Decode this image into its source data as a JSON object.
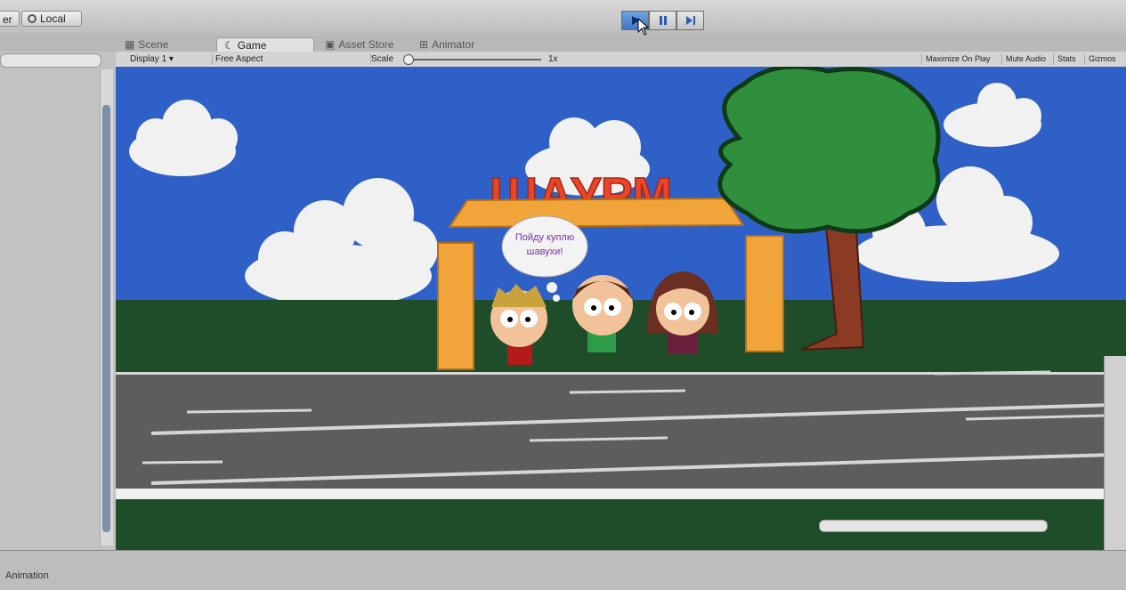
{
  "toolbar": {
    "left_button_label": "er",
    "local_button_label": "Local",
    "play_icon": "play-icon",
    "pause_icon": "pause-icon",
    "step_icon": "step-icon"
  },
  "tabs": [
    {
      "label": "Scene",
      "icon": "scene-icon"
    },
    {
      "label": "Game",
      "icon": "game-icon"
    },
    {
      "label": "Asset Store",
      "icon": "store-icon"
    },
    {
      "label": "Animator",
      "icon": "animator-icon"
    }
  ],
  "gamebar": {
    "display": "Display 1",
    "aspect": "Free Aspect",
    "scale_label": "Scale",
    "scale_value": "1x",
    "options": [
      "Maximize On Play",
      "Mute Audio",
      "Stats",
      "Gizmos"
    ]
  },
  "game": {
    "sign_text": "ШАУРМ",
    "thought_text_line1": "Пойду куплю",
    "thought_text_line2": "шавухи!"
  },
  "bottom": {
    "animation_tab": "Animation"
  },
  "colors": {
    "sky": "#2f60c7",
    "grass": "#1f4d2a",
    "road": "#5d5d5d",
    "sign": "#e8462a",
    "tree": "#2f8f3c",
    "play_active": "#4f86d0"
  }
}
